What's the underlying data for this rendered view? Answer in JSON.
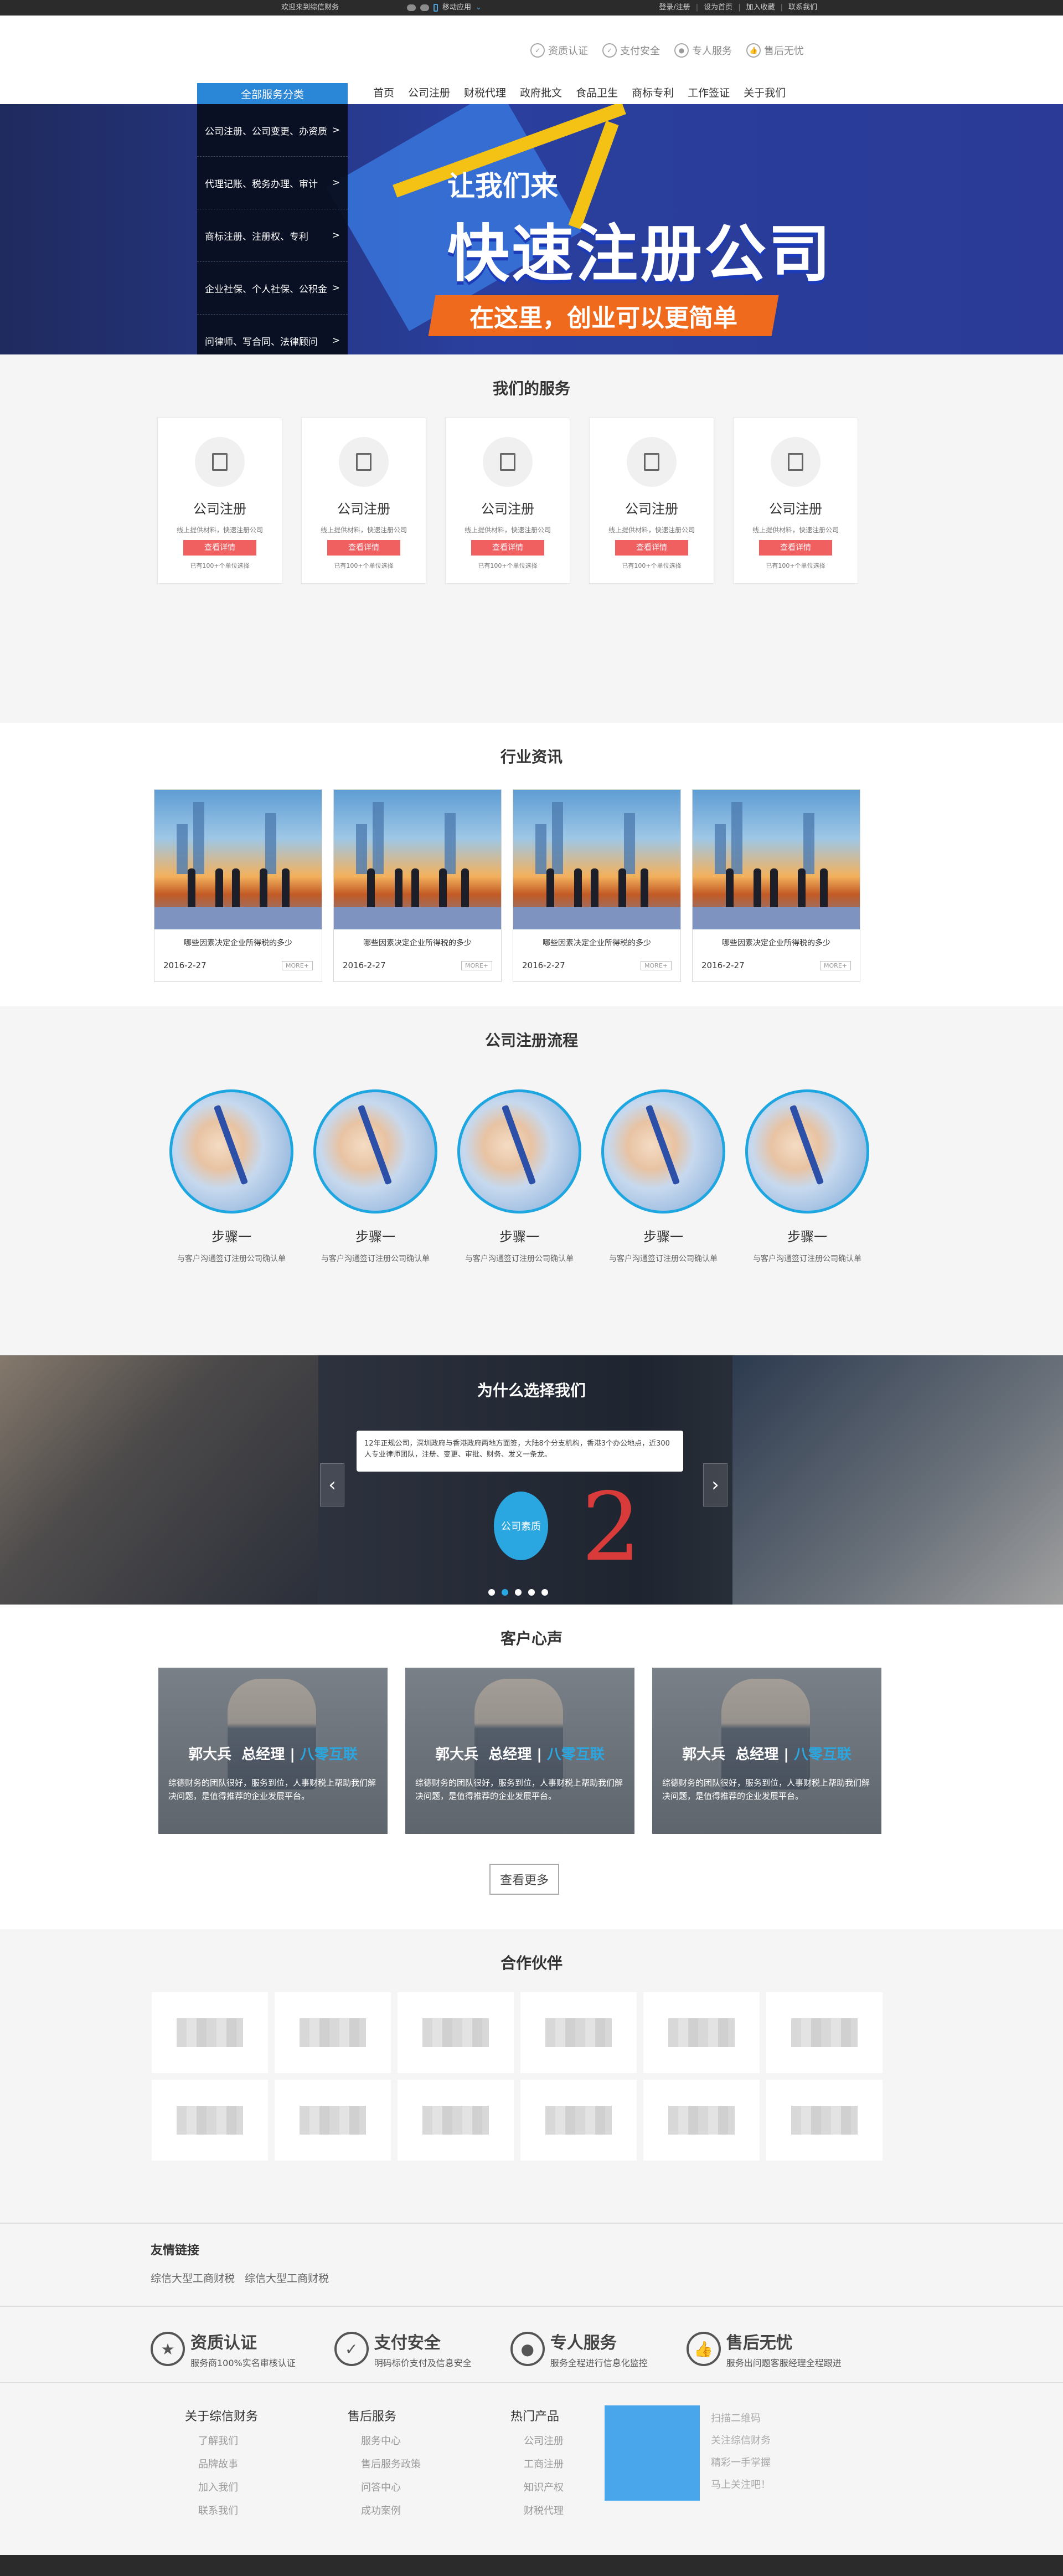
{
  "topbar": {
    "welcome": "欢迎来到综信财务",
    "mobile": "移动应用",
    "links": [
      "登录/注册",
      "设为首页",
      "加入收藏",
      "联系我们"
    ]
  },
  "header": {
    "badges": [
      "资质认证",
      "支付安全",
      "专人服务",
      "售后无忧"
    ]
  },
  "nav": {
    "category": "全部服务分类",
    "links": [
      "首页",
      "公司注册",
      "财税代理",
      "政府批文",
      "食品卫生",
      "商标专利",
      "工作签证",
      "关于我们"
    ]
  },
  "banner": {
    "categories": [
      "公司注册、公司变更、办资质",
      "代理记账、税务办理、审计",
      "商标注册、注册权、专利",
      "企业社保、个人社保、公积金",
      "问律师、写合同、法律顾问"
    ],
    "line1": "让我们来",
    "line2": "快速注册公司",
    "line3": "在这里，创业可以更简单"
  },
  "services": {
    "title": "我们的服务",
    "items": [
      {
        "name": "公司注册",
        "desc": "线上提供材料，快速注册公司",
        "button": "查看详情",
        "count": "已有100+个单位选择"
      },
      {
        "name": "公司注册",
        "desc": "线上提供材料，快速注册公司",
        "button": "查看详情",
        "count": "已有100+个单位选择"
      },
      {
        "name": "公司注册",
        "desc": "线上提供材料，快速注册公司",
        "button": "查看详情",
        "count": "已有100+个单位选择"
      },
      {
        "name": "公司注册",
        "desc": "线上提供材料，快速注册公司",
        "button": "查看详情",
        "count": "已有100+个单位选择"
      },
      {
        "name": "公司注册",
        "desc": "线上提供材料，快速注册公司",
        "button": "查看详情",
        "count": "已有100+个单位选择"
      }
    ]
  },
  "news": {
    "title": "行业资讯",
    "items": [
      {
        "title": "哪些因素决定企业所得税的多少",
        "date": "2016-2-27",
        "more": "MORE+"
      },
      {
        "title": "哪些因素决定企业所得税的多少",
        "date": "2016-2-27",
        "more": "MORE+"
      },
      {
        "title": "哪些因素决定企业所得税的多少",
        "date": "2016-2-27",
        "more": "MORE+"
      },
      {
        "title": "哪些因素决定企业所得税的多少",
        "date": "2016-2-27",
        "more": "MORE+"
      }
    ]
  },
  "process": {
    "title": "公司注册流程",
    "steps": [
      {
        "name": "步骤一",
        "desc": "与客户沟通签订注册公司确认单"
      },
      {
        "name": "步骤一",
        "desc": "与客户沟通签订注册公司确认单"
      },
      {
        "name": "步骤一",
        "desc": "与客户沟通签订注册公司确认单"
      },
      {
        "name": "步骤一",
        "desc": "与客户沟通签订注册公司确认单"
      },
      {
        "name": "步骤一",
        "desc": "与客户沟通签订注册公司确认单"
      }
    ]
  },
  "why": {
    "title": "为什么选择我们",
    "bubble": "12年正规公司，深圳政府与香港政府两地方面签，大陆8个分支机构，香港3个办公地点，近300人专业律师团队，注册、变更、审批、财务、发文一条龙。",
    "ball": "公司素质",
    "number": "2",
    "prev": "‹",
    "next": "›"
  },
  "voice": {
    "title": "客户心声",
    "items": [
      {
        "name": "郭大兵",
        "role": "总经理",
        "sep": "|",
        "company": "八零互联",
        "text": "综德财务的团队很好，服务到位，人事财税上帮助我们解决问题，是值得推荐的企业发展平台。"
      },
      {
        "name": "郭大兵",
        "role": "总经理",
        "sep": "|",
        "company": "八零互联",
        "text": "综德财务的团队很好，服务到位，人事财税上帮助我们解决问题，是值得推荐的企业发展平台。"
      },
      {
        "name": "郭大兵",
        "role": "总经理",
        "sep": "|",
        "company": "八零互联",
        "text": "综德财务的团队很好，服务到位，人事财税上帮助我们解决问题，是值得推荐的企业发展平台。"
      }
    ],
    "more": "查看更多"
  },
  "partners": {
    "title": "合作伙伴",
    "count": 12
  },
  "friends": {
    "title": "友情链接",
    "links": [
      "综信大型工商财税",
      "综信大型工商财税"
    ]
  },
  "guarantees": [
    {
      "title": "资质认证",
      "sub": "服务商100%实名审核认证",
      "icon": "certificate-icon"
    },
    {
      "title": "支付安全",
      "sub": "明码标价支付及信息安全",
      "icon": "shield-icon"
    },
    {
      "title": "专人服务",
      "sub": "服务全程进行信息化监控",
      "icon": "person-icon"
    },
    {
      "title": "售后无忧",
      "sub": "服务出问题客服经理全程跟进",
      "icon": "thumbs-up-icon"
    }
  ],
  "footer": {
    "cols": [
      {
        "title": "关于综信财务",
        "items": [
          "了解我们",
          "品牌故事",
          "加入我们",
          "联系我们"
        ]
      },
      {
        "title": "售后服务",
        "items": [
          "服务中心",
          "售后服务政策",
          "问答中心",
          "成功案例"
        ]
      },
      {
        "title": "热门产品",
        "items": [
          "公司注册",
          "工商注册",
          "知识产权",
          "财税代理"
        ]
      }
    ],
    "qr_text": [
      "扫描二维码",
      "关注综信财务",
      "精彩一手掌握",
      "马上关注吧！"
    ],
    "qr_color": "#4aa6eb"
  }
}
